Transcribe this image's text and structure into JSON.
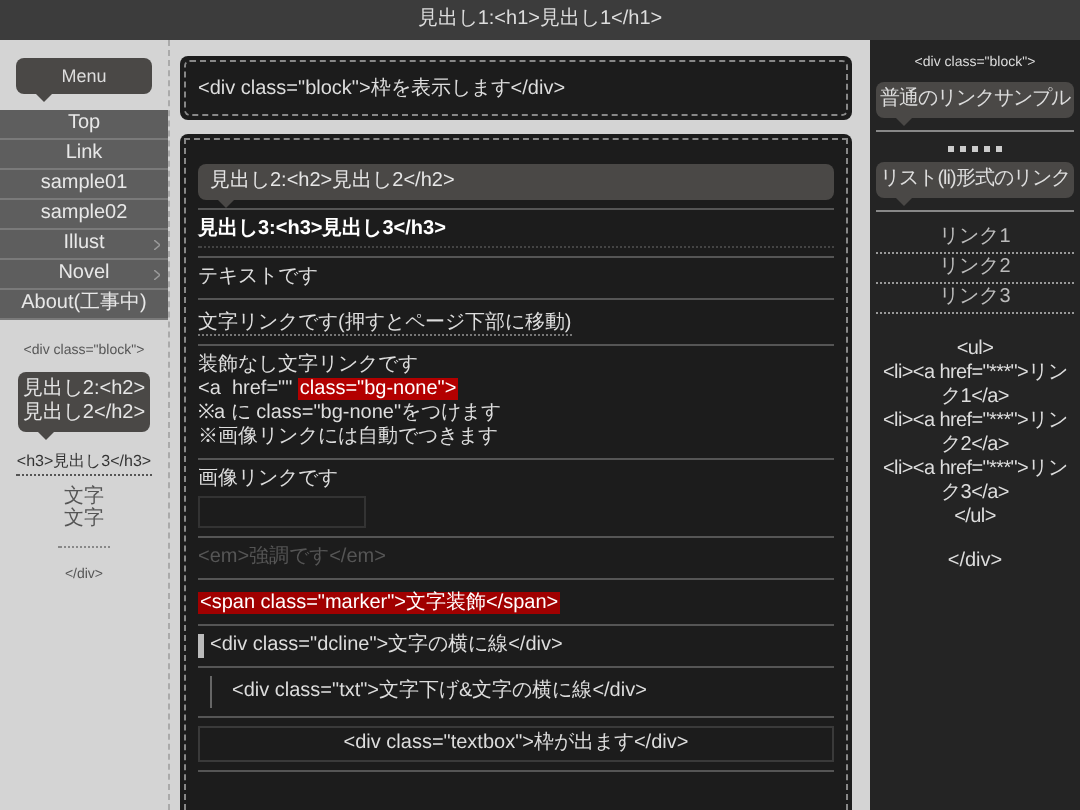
{
  "header": {
    "title": "見出し1:<h1>見出し1</h1>"
  },
  "left_sidebar": {
    "menu_title": "Menu",
    "menu": [
      {
        "label": "Top",
        "has_submenu": false
      },
      {
        "label": "Link",
        "has_submenu": false
      },
      {
        "label": "sample01",
        "has_submenu": false
      },
      {
        "label": "sample02",
        "has_submenu": false
      },
      {
        "label": "Illust",
        "has_submenu": true
      },
      {
        "label": "Novel",
        "has_submenu": true
      },
      {
        "label": "About(工事中)",
        "has_submenu": false
      }
    ],
    "block": {
      "open_tag": "<div class=\"block\">",
      "heading2": "見出し2:<h2>見出し2</h2>",
      "heading3": "<h3>見出し3</h3>",
      "texts": [
        "文字",
        "文字"
      ],
      "close_tag": "</div>"
    }
  },
  "main": {
    "top_block": "<div class=\"block\">枠を表示します</div>",
    "items": [
      {
        "kind": "h2",
        "text": "見出し2:<h2>見出し2</h2>"
      },
      {
        "kind": "h3",
        "text": "見出し3:<h3>見出し3</h3>"
      },
      {
        "kind": "text",
        "text": "テキストです"
      },
      {
        "kind": "link",
        "text": "文字リンクです(押すとページ下部に移動)"
      },
      {
        "kind": "lines",
        "lines": [
          {
            "text": "装飾なし文字リンクです"
          },
          {
            "text": "<a  href=\"\"",
            "highlight": "class=\"bg-none\">"
          },
          {
            "text": "※a に class=\"bg-none\"をつけます"
          },
          {
            "text": "※画像リンクには自動でつきます"
          }
        ]
      },
      {
        "kind": "image_link",
        "text": "画像リンクです"
      },
      {
        "kind": "em",
        "text": "<em>強調です</em>"
      },
      {
        "kind": "marker",
        "text": "<span class=\"marker\">文字装飾</span>"
      },
      {
        "kind": "dcline",
        "text": "<div class=\"dcline\">文字の横に線</div>"
      },
      {
        "kind": "txt",
        "text": "<div class=\"txt\">文字下げ&文字の横に線</div>"
      },
      {
        "kind": "textbox",
        "text": "<div class=\"textbox\">枠が出ます</div>"
      }
    ]
  },
  "right_sidebar": {
    "open_tag": "<div class=\"block\">",
    "heading_a": "普通のリンクサンプル",
    "heading_b": "リスト(li)形式のリンク",
    "links": [
      "リンク1",
      "リンク2",
      "リンク3"
    ],
    "code": [
      "<ul>",
      "<li><a href=\"***\">リンク1</a>",
      "<li><a href=\"***\">リンク2</a>",
      "<li><a href=\"***\">リンク3</a>",
      "</ul>"
    ],
    "close_tag": "</div>"
  }
}
